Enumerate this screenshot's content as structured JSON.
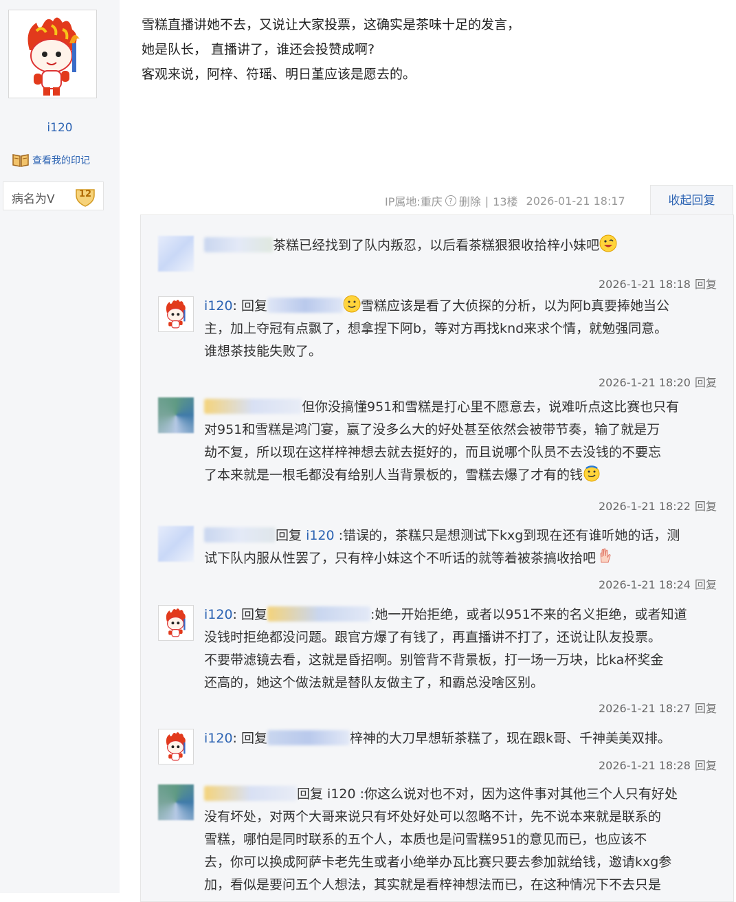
{
  "author": {
    "name": "i120",
    "memory_link": "查看我的印记",
    "level_name": "病名为V",
    "level": "12"
  },
  "post": {
    "lines": [
      "雪糕直播讲她不去，又说让大家投票，这确实是茶味十足的发言，",
      "她是队长， 直播讲了，谁还会投赞成啊?",
      "客观来说，阿梓、符瑶、明日堇应该是愿去的。"
    ],
    "ip_label": "IP属地:重庆",
    "delete": "删除",
    "sep": "|",
    "floor": "13楼",
    "time": "2026-01-21 18:17",
    "collapse": "收起回复"
  },
  "reply_link": "回复",
  "replies": [
    {
      "text": "茶糕已经找到了队内叛忍，以后看茶糕狠狠收拾梓小妹吧",
      "time": "2026-1-21 18:18"
    },
    {
      "name": "i120",
      "prefix": ": 回复",
      "text1": "雪糕应该是看了大侦探的分析，以为阿b真要捧她当公",
      "text2": "主，加上夺冠有点飘了，想拿捏下阿b，等对方再找knd来求个情，就勉强同意。",
      "text3": "谁想茶技能失败了。",
      "time": "2026-1-21 18:20"
    },
    {
      "text1": "但你没搞懂951和雪糕是打心里不愿意去，说难听点这比赛也只有",
      "text2": "对951和雪糕是鸿门宴，赢了没多么大的好处甚至依然会被带节奏，输了就是万",
      "text3": "劫不复，所以现在这样梓神想去就去挺好的，而且说哪个队员不去没钱的不要忘",
      "text4": "了本来就是一根毛都没有给别人当背景板的，雪糕去爆了才有的钱",
      "time": "2026-1-21 18:22"
    },
    {
      "prefix": "回复",
      "target": "i120",
      "text1": ":错误的，茶糕只是想测试下kxg到现在还有谁听她的话，测",
      "text2": "试下队内服从性罢了，只有梓小妹这个不听话的就等着被茶搞收拾吧",
      "time": "2026-1-21 18:24"
    },
    {
      "name": "i120",
      "prefix": ": 回复",
      "text1": ":她一开始拒绝，或者以951不来的名义拒绝，或者知道",
      "text2": "没钱时拒绝都没问题。跟官方爆了有钱了，再直播讲不打了，还说让队友投票。",
      "text3": "不要带滤镜去看，这就是昏招啊。别管背不背景板，打一场一万块，比ka杯奖金",
      "text4": "还高的，她这个做法就是替队友做主了，和霸总没啥区别。",
      "time": "2026-1-21 18:27"
    },
    {
      "name": "i120",
      "prefix": ": 回复",
      "text1": "梓神的大刀早想斩茶糕了，现在跟k哥、千神美美双排。",
      "time": "2026-1-21 18:28"
    },
    {
      "text1": "回复 i120 :你这么说对也不对，因为这件事对其他三个人只有好处",
      "text2": "没有坏处，对两个大哥来说只有坏处好处可以忽略不计，先不说本来就是联系的",
      "text3": "雪糕，哪怕是同时联系的五个人，本质也是问雪糕951的意见而已，也应该不",
      "text4": "去，你可以换成阿萨卡老先生或者小绝举办瓦比赛只要去参加就给钱，邀请kxg参",
      "text5": "加，看似是要问五个人想法，其实就是看梓神想法而已，在这种情况下不去只是"
    }
  ]
}
